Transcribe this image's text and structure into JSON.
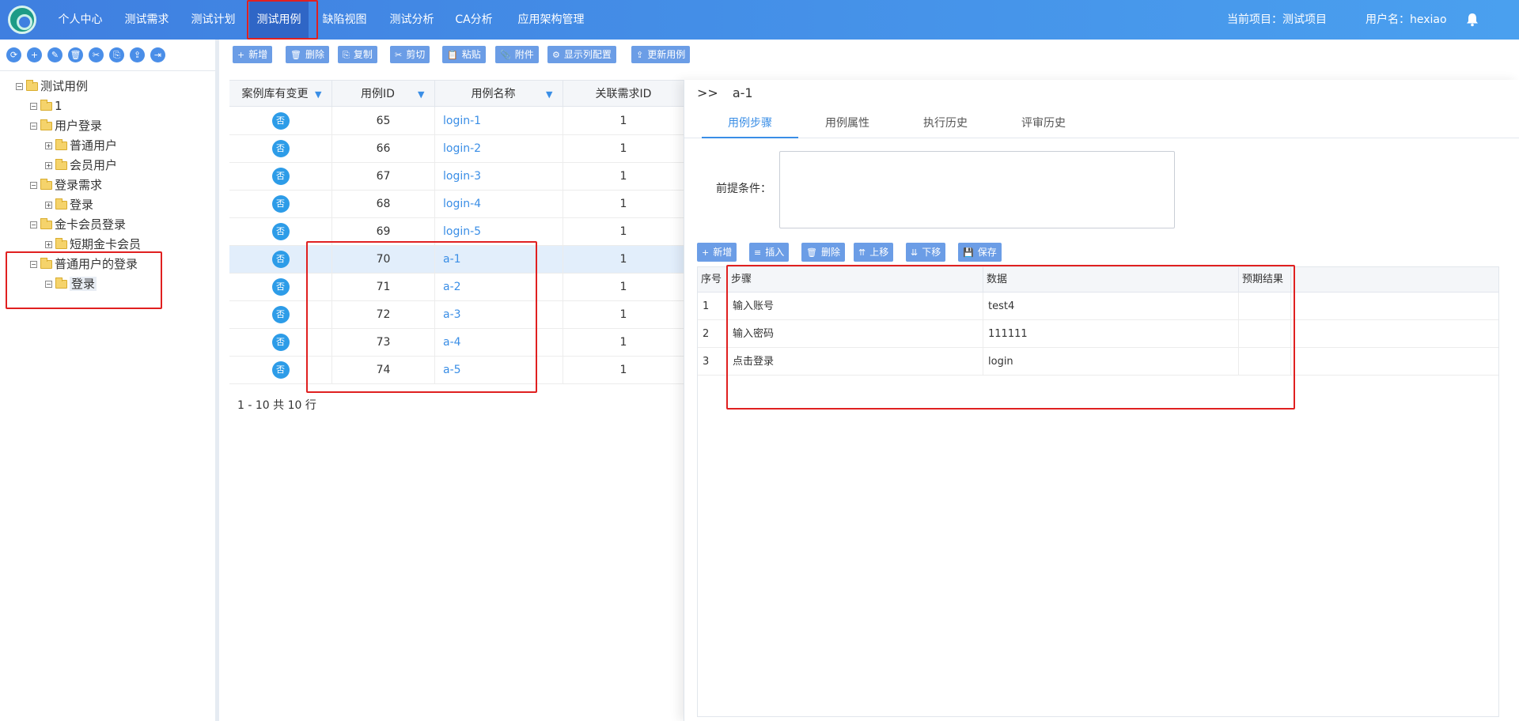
{
  "nav": {
    "items": [
      "个人中心",
      "测试需求",
      "测试计划",
      "测试用例",
      "缺陷视图",
      "测试分析",
      "CA分析",
      "应用架构管理"
    ],
    "active_index": 3,
    "current_project": "当前项目：测试项目",
    "username": "用户名：hexiao"
  },
  "tree_toolbar": {
    "icons": [
      "refresh-icon",
      "add-icon",
      "edit-icon",
      "delete-icon",
      "cut-icon",
      "paste-icon",
      "upload-icon",
      "export-icon"
    ],
    "glyphs": [
      "⟳",
      "+",
      "✎",
      "🗑",
      "✂",
      "⎘",
      "⇪",
      "⇥"
    ]
  },
  "tree": [
    {
      "label": "测试用例",
      "exp": "−"
    },
    {
      "label": "1",
      "exp": "−"
    },
    {
      "label": "用户登录",
      "exp": "−"
    },
    {
      "label": "普通用户",
      "exp": "+"
    },
    {
      "label": "会员用户",
      "exp": "+"
    },
    {
      "label": "登录需求",
      "exp": "−"
    },
    {
      "label": "登录",
      "exp": "+"
    },
    {
      "label": "金卡会员登录",
      "exp": "−"
    },
    {
      "label": "短期金卡会员",
      "exp": "+"
    },
    {
      "label": "普通用户的登录",
      "exp": "−"
    },
    {
      "label": "登录",
      "exp": "−"
    }
  ],
  "toolbar": {
    "buttons": [
      {
        "label": "新增",
        "icon": "+"
      },
      {
        "label": "删除",
        "icon": "🗑"
      },
      {
        "label": "复制",
        "icon": "⎘"
      },
      {
        "label": "剪切",
        "icon": "✂"
      },
      {
        "label": "粘贴",
        "icon": "📋"
      },
      {
        "label": "附件",
        "icon": "📎"
      },
      {
        "label": "显示列配置",
        "icon": "⚙"
      },
      {
        "label": "更新用例",
        "icon": "⇪"
      }
    ]
  },
  "grid": {
    "headers": [
      "案例库有变更",
      "用例ID",
      "用例名称",
      "关联需求ID"
    ],
    "rows": [
      {
        "changed": "否",
        "id": "65",
        "name": "login-1",
        "req": "1"
      },
      {
        "changed": "否",
        "id": "66",
        "name": "login-2",
        "req": "1"
      },
      {
        "changed": "否",
        "id": "67",
        "name": "login-3",
        "req": "1"
      },
      {
        "changed": "否",
        "id": "68",
        "name": "login-4",
        "req": "1"
      },
      {
        "changed": "否",
        "id": "69",
        "name": "login-5",
        "req": "1"
      },
      {
        "changed": "否",
        "id": "70",
        "name": "a-1",
        "req": "1"
      },
      {
        "changed": "否",
        "id": "71",
        "name": "a-2",
        "req": "1"
      },
      {
        "changed": "否",
        "id": "72",
        "name": "a-3",
        "req": "1"
      },
      {
        "changed": "否",
        "id": "73",
        "name": "a-4",
        "req": "1"
      },
      {
        "changed": "否",
        "id": "74",
        "name": "a-5",
        "req": "1"
      }
    ],
    "selected_index": 5,
    "pager": "1 - 10 共 10 行"
  },
  "detail": {
    "arrows": ">>",
    "title": "a-1",
    "tabs": [
      "用例步骤",
      "用例属性",
      "执行历史",
      "评审历史"
    ],
    "active_tab": 0,
    "precondition_label": "前提条件：",
    "precondition_value": "",
    "step_buttons": [
      {
        "label": "新增",
        "icon": "+"
      },
      {
        "label": "插入",
        "icon": "≡"
      },
      {
        "label": "删除",
        "icon": "🗑"
      },
      {
        "label": "上移",
        "icon": "⇈"
      },
      {
        "label": "下移",
        "icon": "⇊"
      },
      {
        "label": "保存",
        "icon": "💾"
      }
    ],
    "step_headers": [
      "序号",
      "步骤",
      "数据",
      "预期结果"
    ],
    "steps": [
      {
        "no": "1",
        "step": "输入账号",
        "data": "test4",
        "expected": ""
      },
      {
        "no": "2",
        "step": "输入密码",
        "data": "111111",
        "expected": ""
      },
      {
        "no": "3",
        "step": "点击登录",
        "data": "login",
        "expected": ""
      }
    ]
  },
  "colors": {
    "accent": "#3a8ee6",
    "nav_active": "#2f66c6",
    "annotation": "#e02020"
  }
}
